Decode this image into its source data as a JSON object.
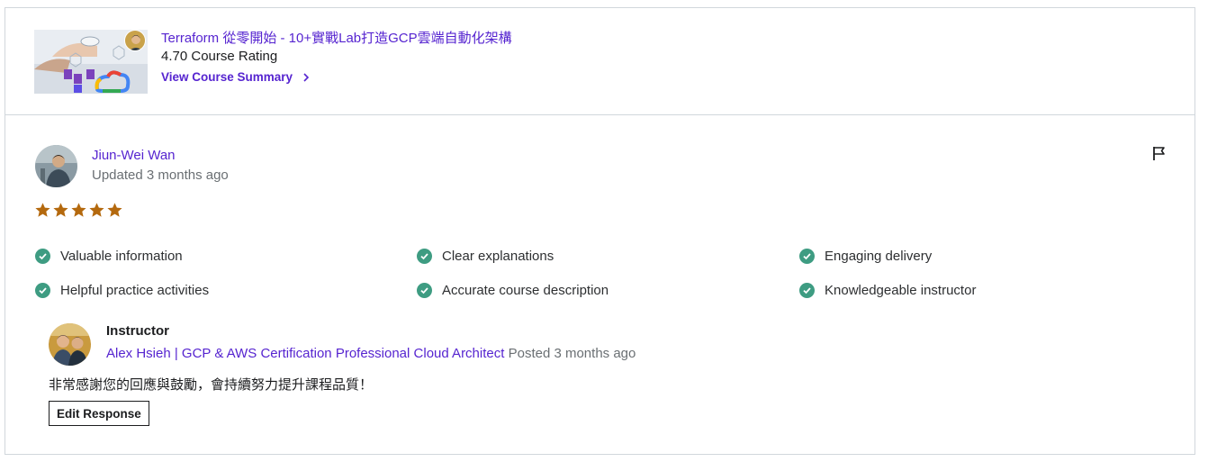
{
  "course": {
    "title": "Terraform 從零開始 - 10+實戰Lab打造GCP雲端自動化架構",
    "rating": "4.70 Course Rating",
    "summary_link": "View Course Summary"
  },
  "review": {
    "reviewer_name": "Jiun-Wei Wan",
    "updated": "Updated 3 months ago",
    "rating_stars": 5,
    "flag_icon": "flag-icon",
    "tags": [
      "Valuable information",
      "Clear explanations",
      "Engaging delivery",
      "Helpful practice activities",
      "Accurate course description",
      "Knowledgeable instructor"
    ]
  },
  "response": {
    "label": "Instructor",
    "instructor_name": "Alex Hsieh | GCP & AWS Certification Professional Cloud Architect",
    "posted": "Posted 3 months ago",
    "text": "非常感謝您的回應與鼓勵，會持續努力提升課程品質！",
    "edit_button": "Edit Response"
  },
  "colors": {
    "link": "#5624d0",
    "star": "#b4690e",
    "check": "#3e9c82",
    "border": "#d1d7dc"
  }
}
